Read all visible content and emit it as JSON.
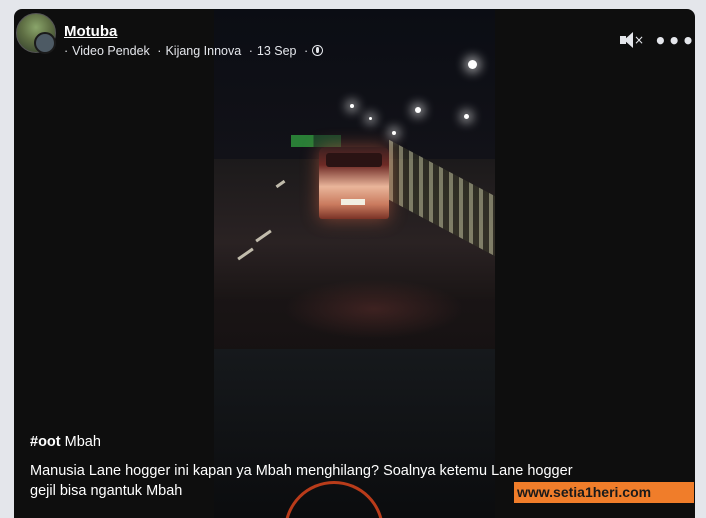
{
  "post": {
    "author": "Motuba",
    "meta": {
      "prefix": "·",
      "category": "Video Pendek",
      "sep1": "·",
      "topic": "Kijang Innova",
      "sep2": "·",
      "date": "13 Sep",
      "sep3": "·"
    },
    "icons": {
      "visibility": "globe-icon",
      "sound": "muted-speaker-icon",
      "menu": "more-options-icon"
    },
    "hashtag": "#oot",
    "hashtag_suffix": "Mbah",
    "caption": "Manusia Lane hogger ini kapan ya Mbah menghilang? Soalnya ketemu Lane hogger gejil bisa ngantuk Mbah"
  },
  "watermark": "www.setia1heri.com",
  "colors": {
    "background": "#e4e6eb",
    "card": "#0e0e0e",
    "watermark_bg": "#f07d2a"
  }
}
